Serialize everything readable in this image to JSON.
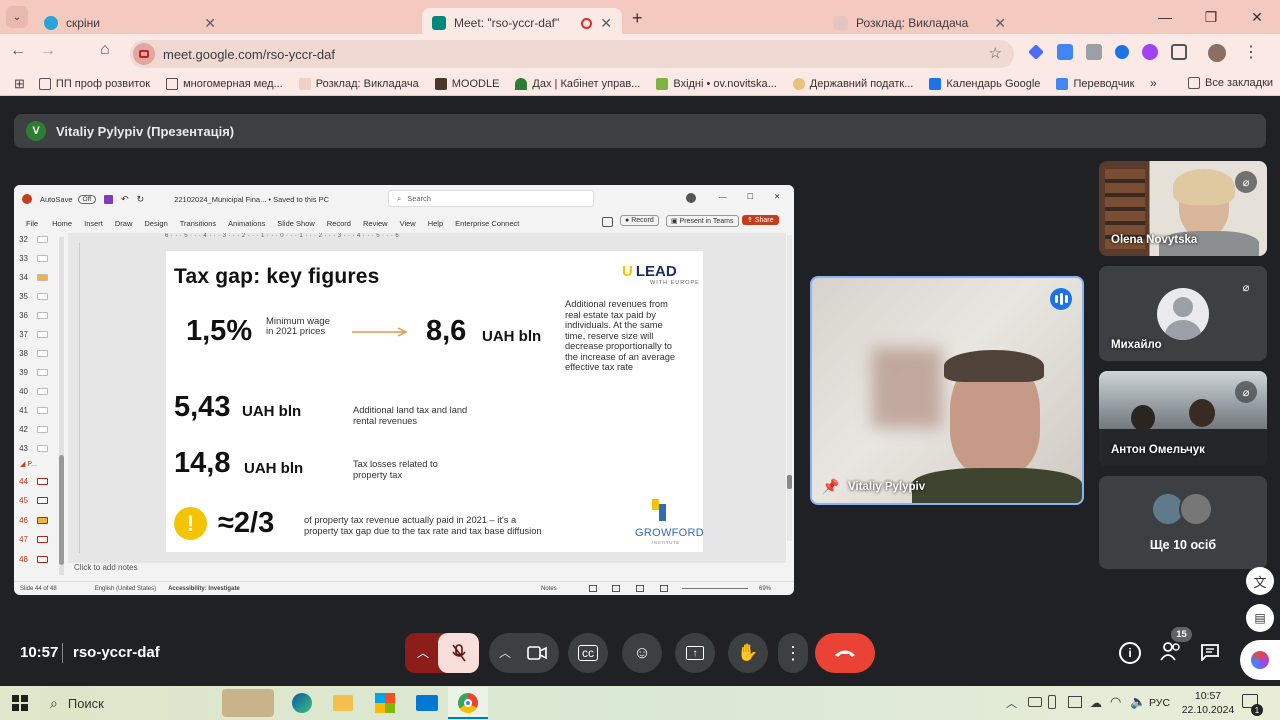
{
  "browser": {
    "tabs": [
      {
        "title": "скріни",
        "active": false,
        "color": "#2aa3db"
      },
      {
        "title": "Meet: \"rso-yccr-daf\"",
        "active": true,
        "color": "#00897b"
      },
      {
        "title": "Розклад: Викладача",
        "active": false,
        "color": "#c8a4a0"
      }
    ],
    "url": "meet.google.com/rso-yccr-daf",
    "bookmarks": [
      "ПП проф розвиток",
      "многомерная мед...",
      "Розклад: Викладача",
      "MOODLE",
      "Дах | Кабінет управ...",
      "Вхідні • ov.novitska...",
      "Державний податк...",
      "Календарь Google",
      "Переводчик"
    ],
    "all_bookmarks": "Все закладки"
  },
  "meet": {
    "presenter_initial": "V",
    "presenter_bar": "Vitaliy Pylypiv (Презентація)",
    "time": "10:57",
    "meeting_code": "rso-yccr-daf",
    "participants_count": "15",
    "tiles": {
      "olena": "Olena Novytska",
      "mykhailo": "Михайло",
      "anton": "Антон Омельчук",
      "more": "Ще 10 осіб",
      "main": "Vitaliy Pylypiv"
    }
  },
  "ppt": {
    "autosave": "AutoSave",
    "toggle": "Off",
    "filename": "22102024_Municipal Fina... • Saved to this PC",
    "search": "Search",
    "menu": [
      "File",
      "Home",
      "Insert",
      "Draw",
      "Design",
      "Transitions",
      "Animations",
      "Slide Show",
      "Record",
      "Review",
      "View",
      "Help",
      "Enterprise Connect"
    ],
    "record": "Record",
    "present_teams": "Present in Teams",
    "share": "Share",
    "slide_numbers": [
      "32",
      "33",
      "34",
      "35",
      "36",
      "37",
      "38",
      "39",
      "40",
      "41",
      "42",
      "43",
      "44",
      "45",
      "46",
      "47",
      "48"
    ],
    "section": "P...",
    "notes": "Click to add notes",
    "status_slide": "Slide 44 of 48",
    "status_lang": "English (United States)",
    "status_access": "Accessibility: Investigate",
    "status_notes": "Notes",
    "zoom": "69%",
    "ruler_top": "6 · · · 5 · · · 4 · · · 3 · · · 2 · · · 1 · · · 0 · · · 1 · · · 2 · · · 3 · · · 4 · · · 5 · · · 6"
  },
  "slide": {
    "title": "Tax gap: key figures",
    "logo_top": "LEAD",
    "logo_u": "U",
    "logo_sub": "WITH EUROPE",
    "logo_bottom": "GROWFORD",
    "logo_bottom_sub": "INSTITUTE",
    "row1_value": "1,5%",
    "row1_label": "Minimum wage in 2021 prices",
    "row1_result": "8,6",
    "row1_unit": "UAH bln",
    "row1_note": "Additional revenues from real estate tax paid by individuals. At the same time, reserve size will decrease proportionally to the increase of an average effective tax rate",
    "row2_value": "5,43",
    "row2_unit": "UAH bln",
    "row2_note": "Additional land tax and land rental revenues",
    "row3_value": "14,8",
    "row3_unit": "UAH bln",
    "row3_note": "Tax losses related to property tax",
    "row4_icon": "!",
    "row4_value": "≈2/3",
    "row4_note": "of property tax revenue actually paid in 2021 – it's a property tax gap due to the tax rate and tax base diffusion"
  },
  "taskbar": {
    "search": "Поиск",
    "lang": "РУС",
    "time": "10:57",
    "date": "22.10.2024",
    "notif_count": "1"
  }
}
